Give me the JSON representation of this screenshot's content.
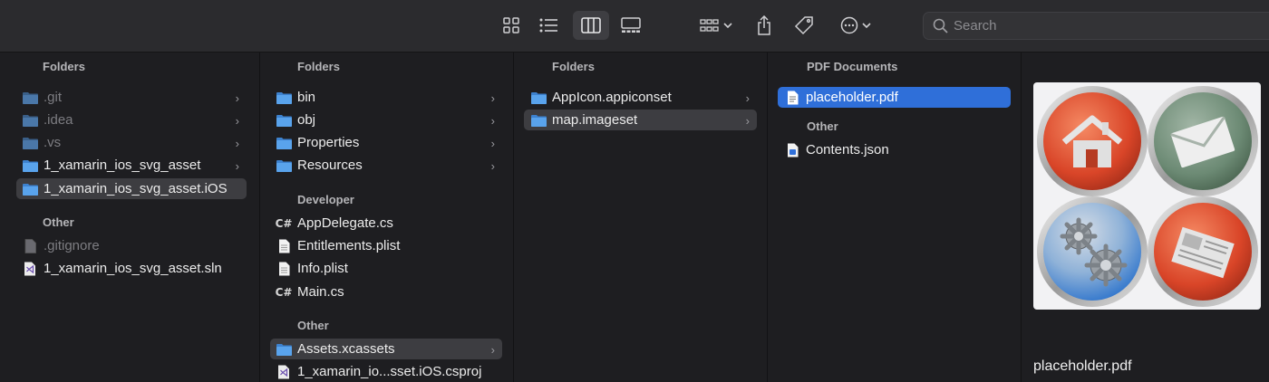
{
  "toolbar": {
    "search_placeholder": "Search",
    "buttons": [
      "icon-view",
      "list-view",
      "column-view",
      "gallery-view",
      "group-menu",
      "share",
      "tags",
      "more-actions"
    ]
  },
  "columns": [
    {
      "sections": [
        {
          "header": "Folders",
          "items": [
            {
              "label": ".git",
              "icon": "folder-icon",
              "dim": true,
              "chevron": true
            },
            {
              "label": ".idea",
              "icon": "folder-icon",
              "dim": true,
              "chevron": true
            },
            {
              "label": ".vs",
              "icon": "folder-icon",
              "dim": true,
              "chevron": true
            },
            {
              "label": "1_xamarin_ios_svg_asset",
              "icon": "folder-icon",
              "chevron": true
            },
            {
              "label": "1_xamarin_ios_svg_asset.iOS",
              "icon": "folder-icon",
              "chevron": true,
              "selected": "grey"
            }
          ]
        },
        {
          "header": "Other",
          "items": [
            {
              "label": ".gitignore",
              "icon": "document-icon",
              "dim": true
            },
            {
              "label": "1_xamarin_ios_svg_asset.sln",
              "icon": "visual-studio-icon"
            }
          ]
        }
      ]
    },
    {
      "sections": [
        {
          "header": "Folders",
          "items": [
            {
              "label": "bin",
              "icon": "folder-icon",
              "chevron": true
            },
            {
              "label": "obj",
              "icon": "folder-icon",
              "chevron": true
            },
            {
              "label": "Properties",
              "icon": "folder-icon",
              "chevron": true
            },
            {
              "label": "Resources",
              "icon": "folder-icon",
              "chevron": true
            }
          ]
        },
        {
          "header": "Developer",
          "items": [
            {
              "label": "AppDelegate.cs",
              "icon": "csharp-icon"
            },
            {
              "label": "Entitlements.plist",
              "icon": "plist-icon"
            },
            {
              "label": "Info.plist",
              "icon": "plist-icon"
            },
            {
              "label": "Main.cs",
              "icon": "csharp-icon"
            }
          ]
        },
        {
          "header": "Other",
          "items": [
            {
              "label": "Assets.xcassets",
              "icon": "folder-icon",
              "chevron": true,
              "selected": "grey"
            },
            {
              "label": "1_xamarin_io...sset.iOS.csproj",
              "icon": "visual-studio-icon"
            }
          ]
        }
      ]
    },
    {
      "sections": [
        {
          "header": "Folders",
          "items": [
            {
              "label": "AppIcon.appiconset",
              "icon": "folder-icon",
              "chevron": true
            },
            {
              "label": "map.imageset",
              "icon": "folder-icon",
              "chevron": true,
              "selected": "grey"
            }
          ]
        }
      ]
    },
    {
      "sections": [
        {
          "header": "PDF Documents",
          "items": [
            {
              "label": "placeholder.pdf",
              "icon": "pdf-icon",
              "selected": "blue"
            }
          ]
        },
        {
          "header": "Other",
          "items": [
            {
              "label": "Contents.json",
              "icon": "json-icon"
            }
          ]
        }
      ]
    }
  ],
  "preview": {
    "filename": "placeholder.pdf",
    "tiles": [
      "home-icon",
      "mail-icon",
      "settings-gears-icon",
      "newspaper-icon"
    ]
  },
  "colors": {
    "accent": "#2f6fd9",
    "folder": "#4f9be8",
    "tile_red": "#e0553a",
    "tile_green": "#6e8b78",
    "tile_blue": "#3f86d8"
  }
}
